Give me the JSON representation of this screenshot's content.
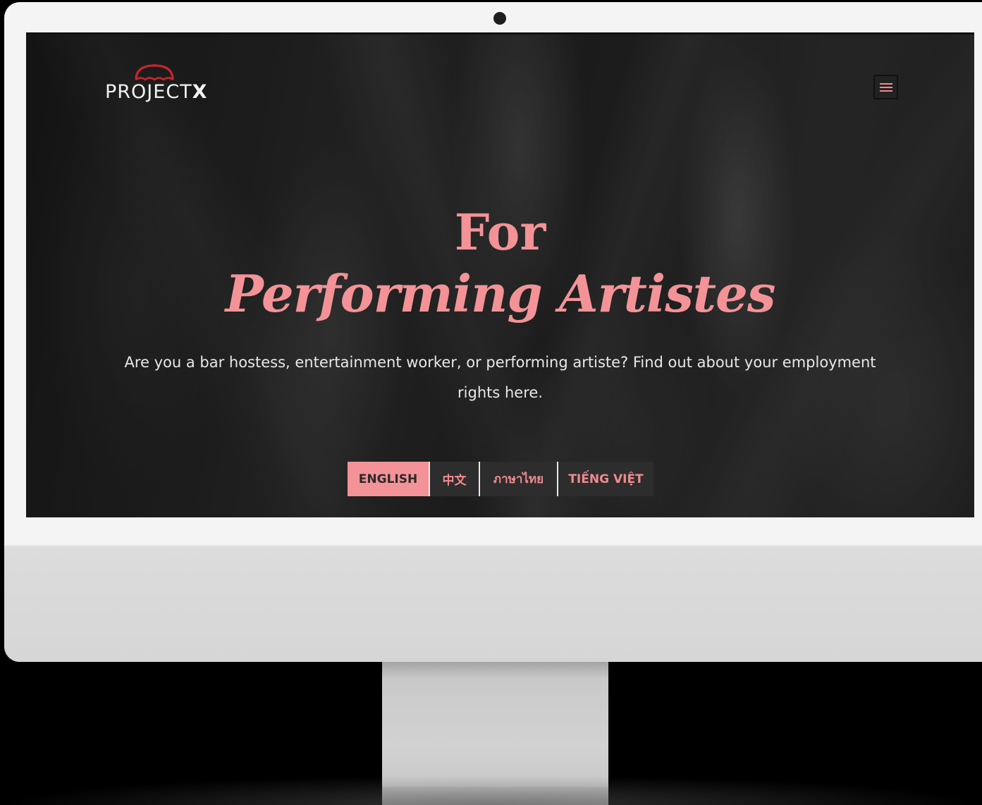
{
  "logo": {
    "text_main": "PROJECT",
    "text_x": "X",
    "icon": "umbrella-icon",
    "icon_color": "#c4262e"
  },
  "menu_button": {
    "icon": "hamburger-menu-icon"
  },
  "hero": {
    "title_line1": "For",
    "title_line2": "Performing Artistes",
    "subtitle": "Are you a bar hostess, entertainment worker, or performing artiste? Find out about your employment rights here."
  },
  "languages": [
    {
      "label": "ENGLISH",
      "active": true
    },
    {
      "label": "中文",
      "active": false
    },
    {
      "label": "ภาษาไทย",
      "active": false
    },
    {
      "label": "TIẾNG VIỆT",
      "active": false
    }
  ],
  "colors": {
    "accent": "#f39397",
    "background": "#232323",
    "text": "#e8e8e8",
    "device_frame": "#f4f4f4"
  }
}
